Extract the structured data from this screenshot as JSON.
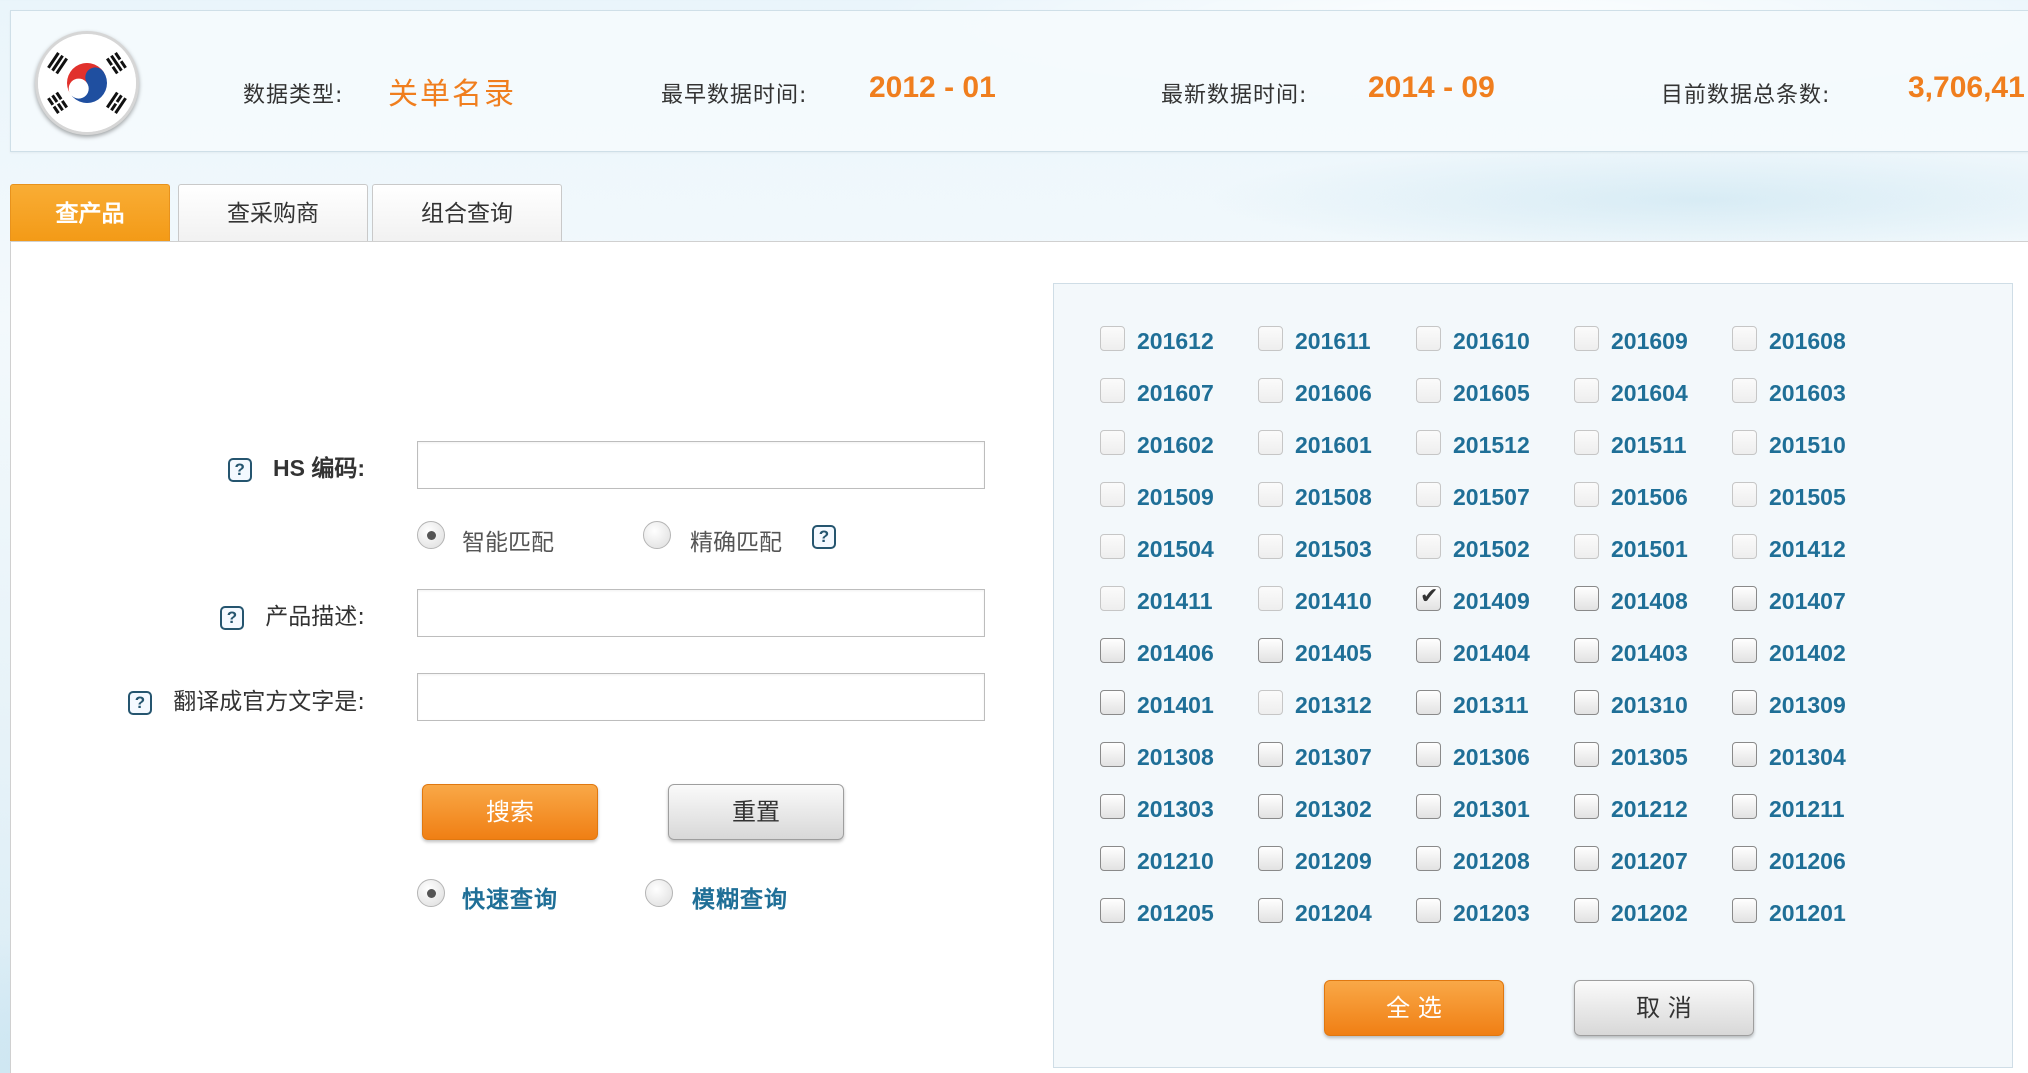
{
  "header": {
    "data_type_label": "数据类型:",
    "data_type_value": "关单名录",
    "earliest_label": "最早数据时间:",
    "earliest_value": "2012 - 01",
    "latest_label": "最新数据时间:",
    "latest_value": "2014 - 09",
    "total_label": "目前数据总条数:",
    "total_value": "3,706,41",
    "flag_icon": "south-korea-flag-icon"
  },
  "tabs": [
    {
      "label": "查产品",
      "active": true
    },
    {
      "label": "查采购商",
      "active": false
    },
    {
      "label": "组合查询",
      "active": false
    }
  ],
  "form": {
    "hs_label": "HS 编码:",
    "match_smart": "智能匹配",
    "match_exact": "精确匹配",
    "desc_label": "产品描述:",
    "translate_label": "翻译成官方文字是:",
    "hs_value": "",
    "desc_value": "",
    "translate_value": "",
    "search_button": "搜索",
    "reset_button": "重置",
    "mode_fast": "快速查询",
    "mode_fuzzy": "模糊查询",
    "help_glyph": "?"
  },
  "months": {
    "items": [
      {
        "label": "201612",
        "state": "faded"
      },
      {
        "label": "201611",
        "state": "faded"
      },
      {
        "label": "201610",
        "state": "faded"
      },
      {
        "label": "201609",
        "state": "faded"
      },
      {
        "label": "201608",
        "state": "faded"
      },
      {
        "label": "201607",
        "state": "faded"
      },
      {
        "label": "201606",
        "state": "faded"
      },
      {
        "label": "201605",
        "state": "faded"
      },
      {
        "label": "201604",
        "state": "faded"
      },
      {
        "label": "201603",
        "state": "faded"
      },
      {
        "label": "201602",
        "state": "faded"
      },
      {
        "label": "201601",
        "state": "faded"
      },
      {
        "label": "201512",
        "state": "faded"
      },
      {
        "label": "201511",
        "state": "faded"
      },
      {
        "label": "201510",
        "state": "faded"
      },
      {
        "label": "201509",
        "state": "faded"
      },
      {
        "label": "201508",
        "state": "faded"
      },
      {
        "label": "201507",
        "state": "faded"
      },
      {
        "label": "201506",
        "state": "faded"
      },
      {
        "label": "201505",
        "state": "faded"
      },
      {
        "label": "201504",
        "state": "faded"
      },
      {
        "label": "201503",
        "state": "faded"
      },
      {
        "label": "201502",
        "state": "faded"
      },
      {
        "label": "201501",
        "state": "faded"
      },
      {
        "label": "201412",
        "state": "faded"
      },
      {
        "label": "201411",
        "state": "faded"
      },
      {
        "label": "201410",
        "state": "faded"
      },
      {
        "label": "201409",
        "state": "checked"
      },
      {
        "label": "201408",
        "state": "normal"
      },
      {
        "label": "201407",
        "state": "normal"
      },
      {
        "label": "201406",
        "state": "normal"
      },
      {
        "label": "201405",
        "state": "normal"
      },
      {
        "label": "201404",
        "state": "normal"
      },
      {
        "label": "201403",
        "state": "normal"
      },
      {
        "label": "201402",
        "state": "normal"
      },
      {
        "label": "201401",
        "state": "normal"
      },
      {
        "label": "201312",
        "state": "faded"
      },
      {
        "label": "201311",
        "state": "normal"
      },
      {
        "label": "201310",
        "state": "normal"
      },
      {
        "label": "201309",
        "state": "normal"
      },
      {
        "label": "201308",
        "state": "normal"
      },
      {
        "label": "201307",
        "state": "normal"
      },
      {
        "label": "201306",
        "state": "normal"
      },
      {
        "label": "201305",
        "state": "normal"
      },
      {
        "label": "201304",
        "state": "normal"
      },
      {
        "label": "201303",
        "state": "normal"
      },
      {
        "label": "201302",
        "state": "normal"
      },
      {
        "label": "201301",
        "state": "normal"
      },
      {
        "label": "201212",
        "state": "normal"
      },
      {
        "label": "201211",
        "state": "normal"
      },
      {
        "label": "201210",
        "state": "normal"
      },
      {
        "label": "201209",
        "state": "normal"
      },
      {
        "label": "201208",
        "state": "normal"
      },
      {
        "label": "201207",
        "state": "normal"
      },
      {
        "label": "201206",
        "state": "normal"
      },
      {
        "label": "201205",
        "state": "normal"
      },
      {
        "label": "201204",
        "state": "normal"
      },
      {
        "label": "201203",
        "state": "normal"
      },
      {
        "label": "201202",
        "state": "normal"
      },
      {
        "label": "201201",
        "state": "normal"
      }
    ],
    "select_all_button": "全 选",
    "cancel_button": "取 消"
  },
  "colors": {
    "accent_orange": "#f07e1e",
    "link_blue": "#1f6f97"
  }
}
